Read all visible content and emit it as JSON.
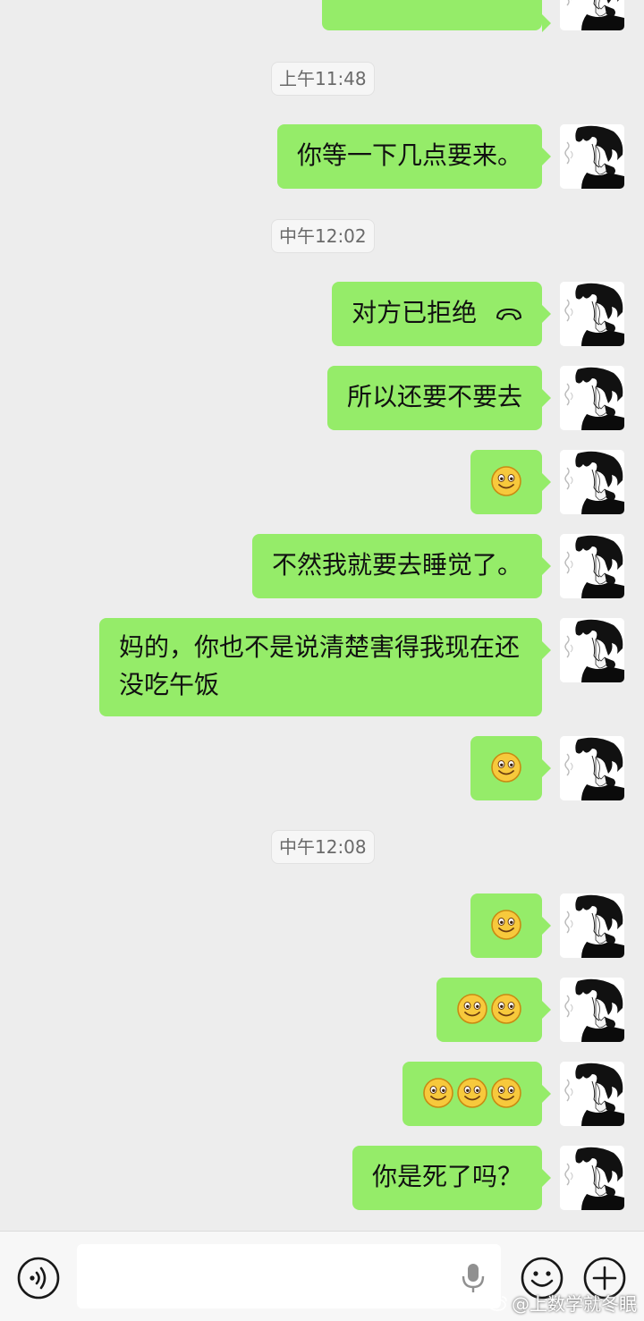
{
  "timestamps": [
    "上午11:48",
    "中午12:02",
    "中午12:08"
  ],
  "messages": [
    {
      "text": "你等一下几点要来。"
    },
    {
      "text": "对方已拒绝",
      "icon": "call-declined-icon"
    },
    {
      "text": "所以还要不要去"
    },
    {
      "emoji_count": 1
    },
    {
      "text": "不然我就要去睡觉了。"
    },
    {
      "text": "妈的，你也不是说清楚害得我现在还没吃午饭"
    },
    {
      "emoji_count": 1
    },
    {
      "emoji_count": 1
    },
    {
      "emoji_count": 2
    },
    {
      "emoji_count": 3
    },
    {
      "text": "你是死了吗？"
    }
  ],
  "input": {
    "value": "",
    "placeholder": ""
  },
  "watermark": "@上数学就冬眠",
  "colors": {
    "bubble": "#95ec69",
    "background": "#ededed",
    "input_bar": "#f7f7f7"
  },
  "icons": [
    "voice-icon",
    "microphone-icon",
    "emoji-icon",
    "plus-icon",
    "smile-emoji-icon",
    "weibo-logo-icon"
  ]
}
